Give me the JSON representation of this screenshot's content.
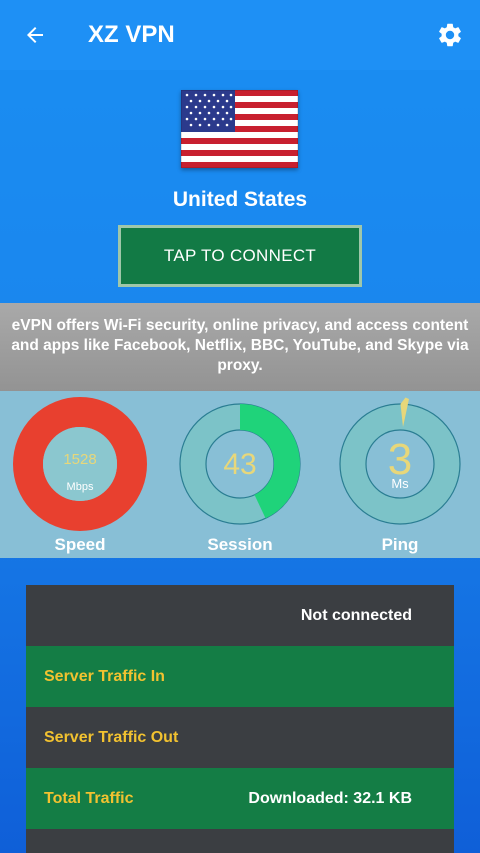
{
  "appbar": {
    "title": "XZ VPN"
  },
  "location": {
    "country": "United States"
  },
  "connect": {
    "label": "TAP TO CONNECT"
  },
  "info_text": "eVPN offers Wi-Fi security, online privacy, and access content and apps like Facebook, Netflix, BBC, YouTube, and Skype via proxy.",
  "stats": {
    "speed": {
      "value": "1528",
      "unit": "Mbps",
      "label": "Speed"
    },
    "session": {
      "value": "43",
      "label": "Session",
      "fill_fraction": 0.43
    },
    "ping": {
      "value": "3",
      "unit": "Ms",
      "label": "Ping"
    }
  },
  "traffic": {
    "status": "Not connected",
    "rows": [
      {
        "label": "Server Traffic In",
        "value": ""
      },
      {
        "label": "Server Traffic Out",
        "value": ""
      },
      {
        "label": "Total Traffic",
        "value": "Downloaded: 32.1 KB"
      },
      {
        "label": "",
        "value": ""
      }
    ]
  },
  "colors": {
    "appbar": "#1e90f5",
    "connect_button": "#127a45",
    "speed_ring": "#e8402f",
    "session_arc": "#1fd37a",
    "gauge_value": "#e7d77a",
    "row_label": "#f2c230"
  }
}
